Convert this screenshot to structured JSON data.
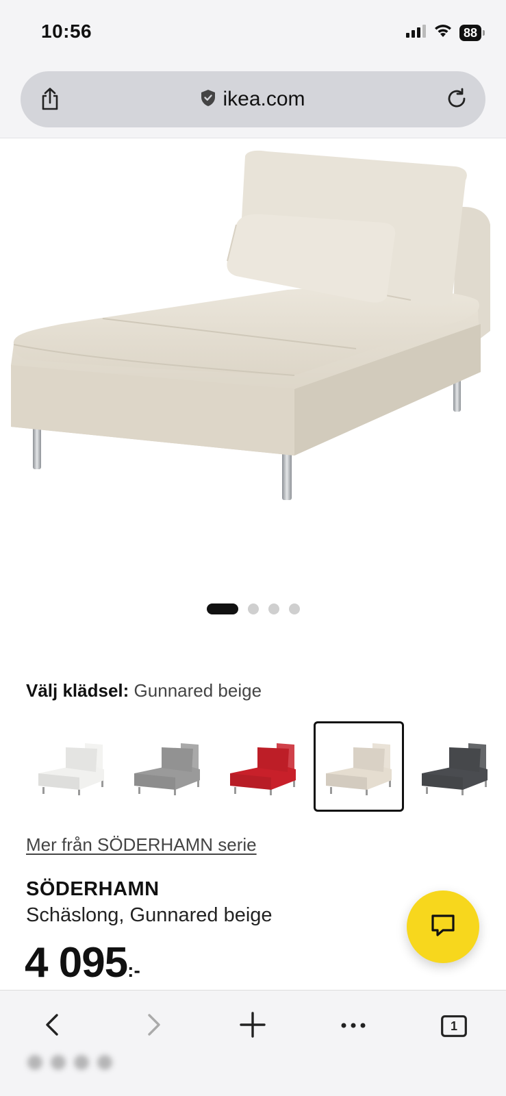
{
  "status_bar": {
    "time": "10:56",
    "battery": "88"
  },
  "browser": {
    "url": "ikea.com",
    "icons": [
      "share-icon",
      "lock-shield-icon",
      "reload-icon"
    ]
  },
  "product_image": {
    "icon": "chaise-longue-image",
    "carousel_total": 4,
    "carousel_active": 1
  },
  "upholstery": {
    "label": "Välj klädsel:",
    "selected_value": "Gunnared beige",
    "swatch_colors": [
      "#f1f1ef",
      "#9a9a9a",
      "#c8202a",
      "#e5ddd0",
      "#4a4c50"
    ],
    "selected_index": 3
  },
  "series_link": "Mer från SÖDERHAMN serie",
  "product": {
    "name": "SÖDERHAMN",
    "description": "Schäslong, Gunnared beige",
    "price": "4 095",
    "price_suffix": ":-"
  },
  "chat": {
    "icon": "chat-icon",
    "color": "#f7d71d"
  },
  "toolbar": {
    "tabs_count": "1",
    "icons": [
      "back-icon",
      "forward-icon",
      "new-tab-icon",
      "more-icon",
      "tabs-icon"
    ]
  }
}
